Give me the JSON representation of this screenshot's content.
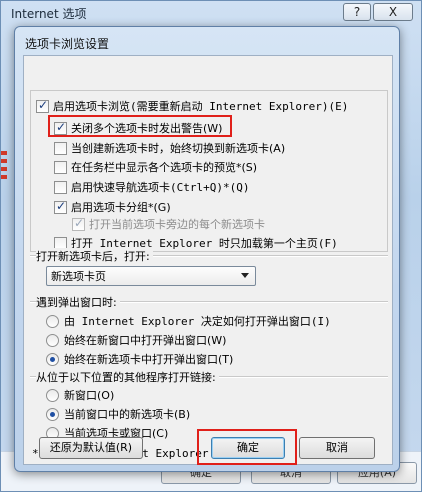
{
  "outer": {
    "title": "Internet 选项",
    "help": "?",
    "close": "X",
    "bottom_ok": "确定",
    "bottom_cancel": "取消",
    "bottom_apply": "应用(A)"
  },
  "dialog": {
    "title": "选项卡浏览设置",
    "options": {
      "enable_tabs": "启用选项卡浏览(需要重新启动 Internet Explorer)(E)",
      "warn_close": "关闭多个选项卡时发出警告(W)",
      "switch_new": "当创建新选项卡时，始终切换到新选项卡(A)",
      "taskbar_preview": "在任务栏中显示各个选项卡的预览*(S)",
      "quick_nav": "启用快速导航选项卡(Ctrl+Q)*(Q)",
      "tab_groups": "启用选项卡分组*(G)",
      "open_next": "打开当前选项卡旁边的每个新选项卡",
      "first_home": "打开 Internet Explorer 时只加载第一个主页(F)"
    },
    "new_tab_group": {
      "label": "打开新选项卡后，打开:",
      "selected": "新选项卡页"
    },
    "popup_group": {
      "label": "遇到弹出窗口时:",
      "options": [
        "由 Internet Explorer 决定如何打开弹出窗口(I)",
        "始终在新窗口中打开弹出窗口(W)",
        "始终在新选项卡中打开弹出窗口(T)"
      ],
      "selected": 2
    },
    "external_group": {
      "label": "从位于以下位置的其他程序打开链接:",
      "options": [
        "新窗口(O)",
        "当前窗口中的新选项卡(B)",
        "当前选项卡或窗口(C)"
      ],
      "selected": 1
    },
    "footnote": "* 重新启动 Internet Explorer 之后生效",
    "buttons": {
      "restore": "还原为默认值(R)",
      "ok": "确定",
      "cancel": "取消"
    }
  },
  "colors": {
    "highlight": "#e0201a",
    "accent": "#1f4fa3"
  }
}
